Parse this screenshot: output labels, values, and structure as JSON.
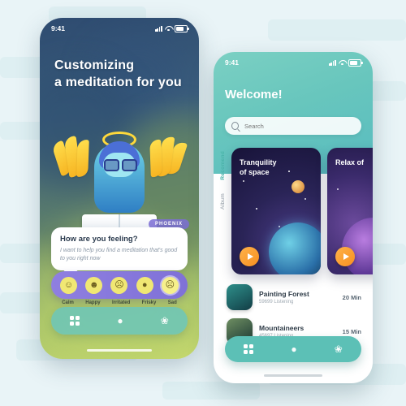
{
  "phone1": {
    "status": {
      "time": "9:41",
      "signal_icon": "signal-bars-icon",
      "wifi_icon": "wifi-icon",
      "battery_icon": "battery-icon"
    },
    "title_line1": "Customizing",
    "title_line2": "a meditation for you",
    "character_badge": "PHOENIX",
    "bubble": {
      "question": "How are you feeling?",
      "answer": "I want to help you find a meditation that's good to you right now"
    },
    "moods": [
      {
        "label": "Calm",
        "emoji": "☺",
        "active": false
      },
      {
        "label": "Happy",
        "emoji": "☻",
        "active": false
      },
      {
        "label": "Irritated",
        "emoji": "☹",
        "active": false
      },
      {
        "label": "Frisky",
        "emoji": "●",
        "active": false
      },
      {
        "label": "Sad",
        "emoji": "☹",
        "active": true
      }
    ],
    "tabbar": [
      {
        "icon": "grid-icon",
        "glyph": "■"
      },
      {
        "icon": "person-icon",
        "glyph": "●"
      },
      {
        "icon": "lotus-icon",
        "glyph": "❀"
      }
    ]
  },
  "phone2": {
    "status": {
      "time": "9:41",
      "signal_icon": "signal-bars-icon",
      "wifi_icon": "wifi-icon",
      "battery_icon": "battery-icon"
    },
    "greeting": "Welcome!",
    "search": {
      "placeholder": "Search",
      "value": "",
      "icon": "search-icon"
    },
    "side_tabs": [
      {
        "label": "Recomend",
        "active": true
      },
      {
        "label": "Album",
        "active": false
      }
    ],
    "cards": [
      {
        "title_line1": "Tranquility",
        "title_line2": "of space",
        "play_icon": "play-icon"
      },
      {
        "title_line1": "Relax of",
        "title_line2": "",
        "play_icon": "play-icon"
      }
    ],
    "list": [
      {
        "title": "Painting Forest",
        "sub": "59699 Listening",
        "time": "20 Min"
      },
      {
        "title": "Mountaineers",
        "sub": "45697 Listening",
        "time": "15 Min"
      }
    ],
    "tabbar": [
      {
        "icon": "grid-icon",
        "glyph": "■"
      },
      {
        "icon": "person-icon",
        "glyph": "●"
      },
      {
        "icon": "lotus-icon",
        "glyph": "❀"
      }
    ]
  },
  "colors": {
    "accent_teal": "#5cc0b6",
    "accent_purple": "#8f7fe0",
    "accent_orange": "#f79020",
    "background": "#e9f4f7"
  }
}
